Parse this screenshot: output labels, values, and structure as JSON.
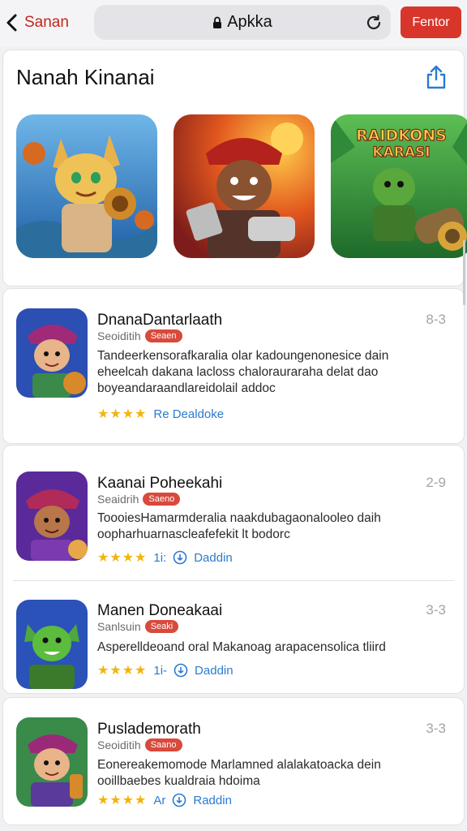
{
  "nav": {
    "back_label": "Sanan",
    "url_text": "Apkka",
    "primary_button_label": "Fentor"
  },
  "featured": {
    "title": "Nanah Kinanai",
    "tiles": [
      {
        "name": "Fox warrior tile"
      },
      {
        "name": "Bandit tile"
      },
      {
        "name": "RAIDKONS KARASI",
        "art_text": "RAIDKONS KARASI"
      }
    ]
  },
  "apps": [
    {
      "name": "DnanaDantarlaath",
      "meta": "Seoiditih",
      "badge": "Seaen",
      "corner": "8-3",
      "description": "Tandeerkensorafkaralia olar kadoungenonesice dain eheelcah dakana lacloss chalorauraraha delat dao boyeandaraandlareidolail addoc",
      "stars": "★★★★",
      "rating": "Re Dealdoke"
    },
    {
      "name": "Kaanai Poheekahi",
      "meta": "Seaidrih",
      "badge": "Saeno",
      "corner": "2-9",
      "description": "ToooiesHamarmderalia naakdubagaonalooleo daih oopharhuarnascleafefekit lt bodorc",
      "stars": "★★★★",
      "count": "1i:",
      "action": "Daddin"
    },
    {
      "name": "Manen Doneakaai",
      "meta": "Sanlsuin",
      "badge": "Seaki",
      "corner": "3-3",
      "description": "Asperelldeoand oral Makanoag arapacensolica tliird",
      "stars": "★★★★",
      "count": "1i-",
      "action": "Daddin"
    },
    {
      "name": "Puslademorath",
      "meta": "Seoiditih",
      "badge": "Saano",
      "corner": "3-3",
      "description": "Eonereakemomode Marlamned alalakatoacka dein ooillbaebes kualdraia hdoima",
      "stars": "★★★★",
      "count": "Ar",
      "action": "Raddin"
    }
  ],
  "colors": {
    "accent_red": "#d8362b",
    "link_blue": "#2a7bd2",
    "star_yellow": "#f2b50c"
  },
  "icons": [
    "chevron-left-icon",
    "lock-icon",
    "reload-icon",
    "share-icon",
    "star-icon",
    "download-ring-icon"
  ]
}
